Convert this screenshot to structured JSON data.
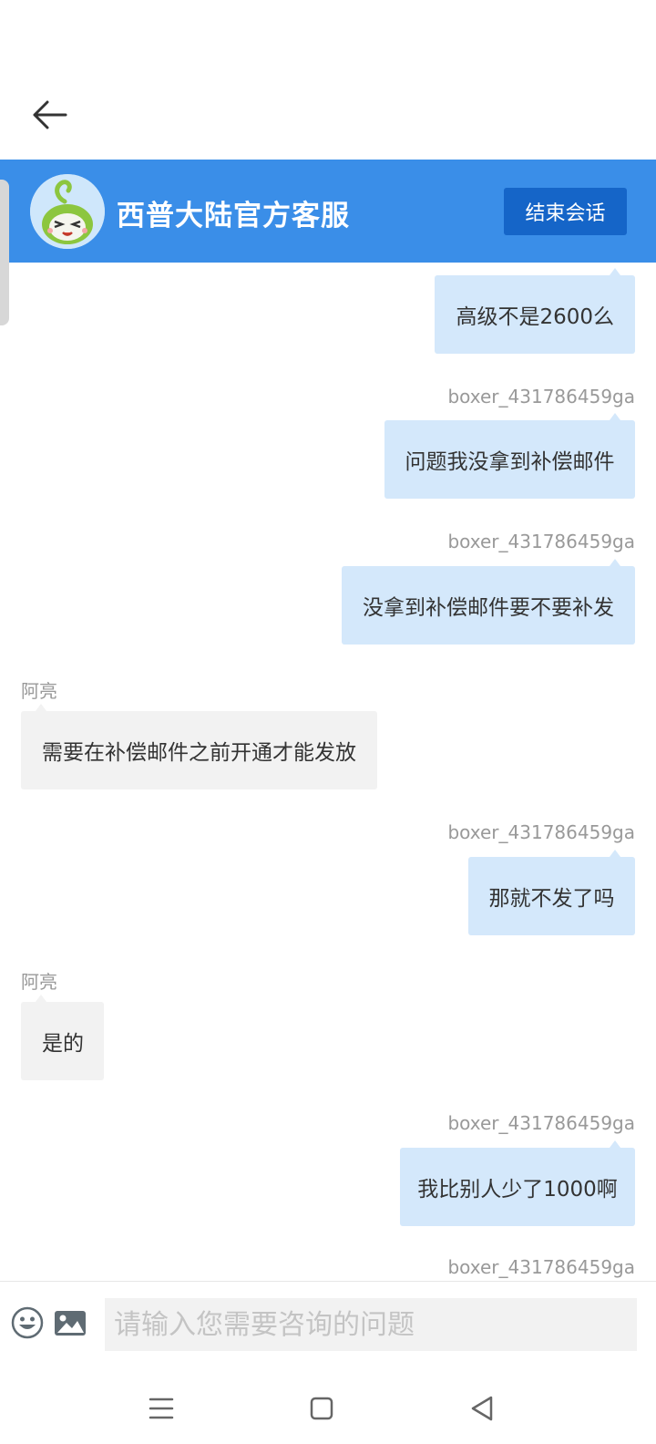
{
  "header": {
    "title": "西普大陆官方客服",
    "end_button_label": "结束会话"
  },
  "icons": {
    "back": "arrow-left-icon",
    "avatar": "green-mascot-avatar",
    "emoji": "smiley-icon",
    "image": "image-icon",
    "nav_menu": "menu-lines-icon",
    "nav_home": "square-home-icon",
    "nav_back": "triangle-back-icon"
  },
  "colors": {
    "header_bg": "#3a8ee8",
    "end_button_bg": "#1565c8",
    "user_bubble": "#d4e8fb",
    "agent_bubble": "#f2f2f2"
  },
  "messages": [
    {
      "side": "right",
      "sender": "",
      "text": "高级不是2600么"
    },
    {
      "side": "right",
      "sender": "boxer_431786459ga",
      "text": "问题我没拿到补偿邮件"
    },
    {
      "side": "right",
      "sender": "boxer_431786459ga",
      "text": "没拿到补偿邮件要不要补发"
    },
    {
      "side": "left",
      "sender": "阿亮",
      "text": "需要在补偿邮件之前开通才能发放"
    },
    {
      "side": "right",
      "sender": "boxer_431786459ga",
      "text": "那就不发了吗"
    },
    {
      "side": "left",
      "sender": "阿亮",
      "text": "是的"
    },
    {
      "side": "right",
      "sender": "boxer_431786459ga",
      "text": "我比别人少了1000啊"
    },
    {
      "side": "right",
      "sender": "boxer_431786459ga",
      "text": ""
    }
  ],
  "input": {
    "placeholder": "请输入您需要咨询的问题",
    "value": ""
  }
}
